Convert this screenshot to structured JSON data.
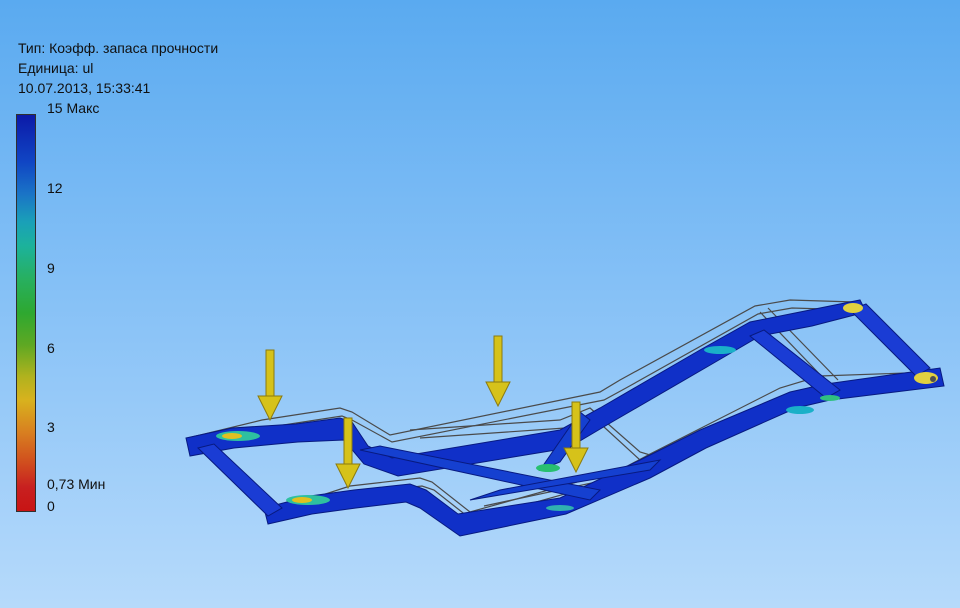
{
  "header": {
    "type_line": "Тип: Коэфф. запаса прочности",
    "unit_line": "Единица: ul",
    "date_line": "10.07.2013, 15:33:41"
  },
  "legend": {
    "labels": [
      "15 Макс",
      "12",
      "9",
      "6",
      "3",
      "0,73 Мин",
      "0"
    ],
    "max": 15,
    "min": 0.73,
    "colors": [
      "#0c1aa8",
      "#1aa0b8",
      "#2ea830",
      "#d8b21e",
      "#c81414"
    ]
  },
  "scene": {
    "description_icon": "frame-mesh",
    "load_arrow_color": "#d6c21a"
  }
}
